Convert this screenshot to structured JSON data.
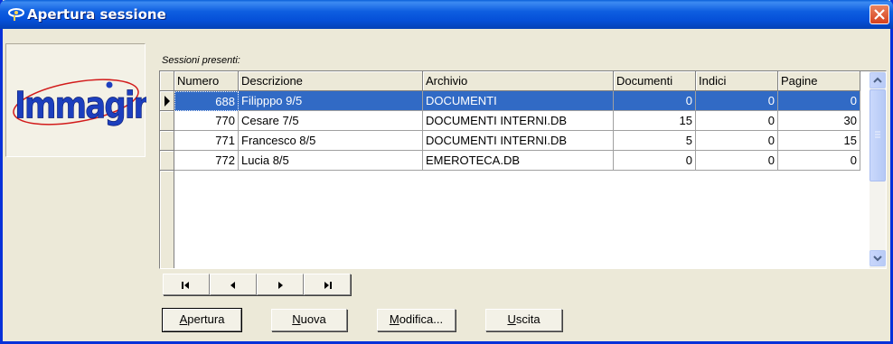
{
  "window": {
    "title": "Apertura sessione"
  },
  "logo": {
    "text": "Immagina"
  },
  "grid": {
    "label": "Sessioni presenti:",
    "columns": [
      "Numero",
      "Descrizione",
      "Archivio",
      "Documenti",
      "Indici",
      "Pagine"
    ],
    "rows": [
      {
        "numero": "688",
        "descrizione": "Filipppo 9/5",
        "archivio": "DOCUMENTI",
        "documenti": "0",
        "indici": "0",
        "pagine": "0",
        "selected": true
      },
      {
        "numero": "770",
        "descrizione": "Cesare 7/5",
        "archivio": "DOCUMENTI INTERNI.DB",
        "documenti": "15",
        "indici": "0",
        "pagine": "30"
      },
      {
        "numero": "771",
        "descrizione": "Francesco 8/5",
        "archivio": "DOCUMENTI INTERNI.DB",
        "documenti": "5",
        "indici": "0",
        "pagine": "15"
      },
      {
        "numero": "772",
        "descrizione": "Lucia 8/5",
        "archivio": "EMEROTECA.DB",
        "documenti": "0",
        "indici": "0",
        "pagine": "0"
      }
    ]
  },
  "buttons": {
    "apertura": {
      "first": "A",
      "rest": "pertura"
    },
    "nuova": {
      "first": "N",
      "rest": "uova"
    },
    "modifica": {
      "first": "M",
      "rest": "odifica..."
    },
    "uscita": {
      "first": "U",
      "rest": "scita"
    }
  },
  "colors": {
    "selection": "#316ac5",
    "titlebar": "#0550d8",
    "face": "#ece9d8"
  },
  "icons": {
    "nav": [
      "first-record-icon",
      "prev-record-icon",
      "next-record-icon",
      "last-record-icon"
    ]
  }
}
